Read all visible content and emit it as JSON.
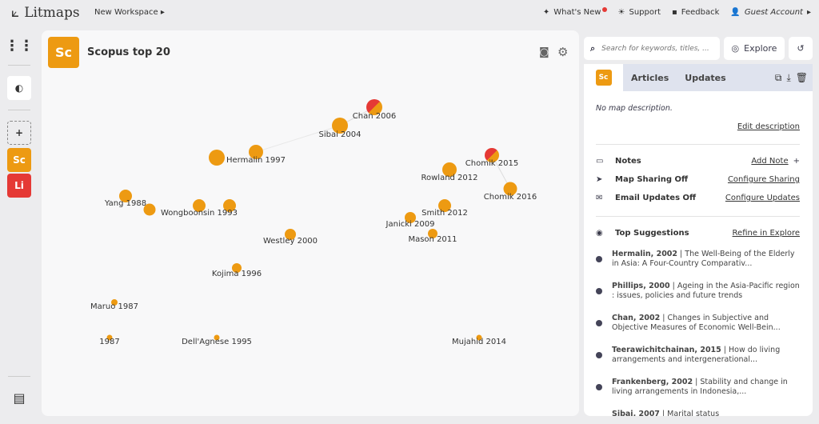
{
  "header": {
    "logo": "Litmaps",
    "workspace": "New Workspace",
    "whats_new": "What's New",
    "support": "Support",
    "feedback": "Feedback",
    "account": "Guest Account"
  },
  "sidebar": {
    "items": [
      {
        "abbr": "Sc",
        "color": "#ed9a12"
      },
      {
        "abbr": "Li",
        "color": "#e53935"
      }
    ],
    "add": "+"
  },
  "map": {
    "badge": "Sc",
    "title": "Scopus top 20",
    "nodes": [
      {
        "label": "Chan 2006"
      },
      {
        "label": "Sibai 2004"
      },
      {
        "label": "Hermalin 1997"
      },
      {
        "label": "Chomik 2015"
      },
      {
        "label": "Rowland 2012"
      },
      {
        "label": "Chomik 2016"
      },
      {
        "label": "Yang 1988"
      },
      {
        "label": "Wongboonsin 1993"
      },
      {
        "label": "Smith 2012"
      },
      {
        "label": "Janicki 2009"
      },
      {
        "label": "Mason 2011"
      },
      {
        "label": "Westley 2000"
      },
      {
        "label": "Kojima 1996"
      },
      {
        "label": "Maruo 1987"
      },
      {
        "label": "1987"
      },
      {
        "label": "Dell'Agnese 1995"
      },
      {
        "label": "Mujahid 2014"
      }
    ]
  },
  "search": {
    "placeholder": "Search for keywords, titles, ..."
  },
  "explore": "Explore",
  "panel": {
    "tab_badge": "Sc",
    "tabs": [
      "Articles",
      "Updates"
    ],
    "description": "No map description.",
    "edit_description": "Edit description",
    "notes": "Notes",
    "add_note": "Add Note",
    "plus": "+",
    "sharing": "Map Sharing Off",
    "configure_sharing": "Configure Sharing",
    "email": "Email Updates Off",
    "configure_updates": "Configure Updates",
    "top_suggestions": "Top Suggestions",
    "refine": "Refine in Explore",
    "suggestions": [
      {
        "author": "Hermalin, 2002",
        "title": " | The Well-Being of the Elderly in Asia: A Four-Country Comparativ..."
      },
      {
        "author": "Phillips, 2000",
        "title": " | Ageing in the Asia-Pacific region : issues, policies and future trends"
      },
      {
        "author": "Chan, 2002",
        "title": " | Changes in Subjective and Objective Measures of Economic Well-Bein..."
      },
      {
        "author": "Teerawichitchainan, 2015",
        "title": " | How do living arrangements and intergenerational..."
      },
      {
        "author": "Frankenberg, 2002",
        "title": " | Stability and change in living arrangements in Indonesia,..."
      },
      {
        "author": "Sibai, 2007",
        "title": " | Marital status"
      }
    ]
  },
  "colors": {
    "accent": "#ed9a12",
    "red": "#e53935"
  }
}
